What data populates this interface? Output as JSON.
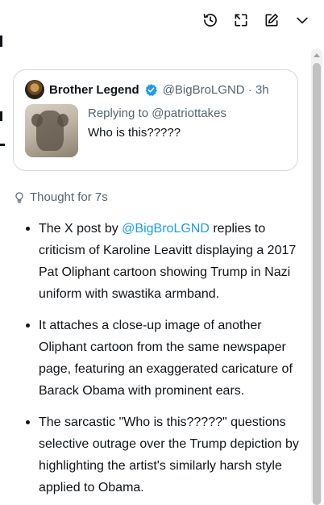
{
  "toolbar": {
    "buttons": [
      {
        "name": "history",
        "icon": "history-icon"
      },
      {
        "name": "expand",
        "icon": "expand-icon"
      },
      {
        "name": "new-chat",
        "icon": "compose-icon"
      },
      {
        "name": "collapse",
        "icon": "chevron-down-icon"
      }
    ]
  },
  "tweet": {
    "author": "Brother Legend",
    "handle_time": "@BigBroLGND · 3h",
    "replying_prefix": "Replying to ",
    "replying_to": "@patriottakes",
    "text": "Who is this?????"
  },
  "thought": {
    "label": "Thought for 7s",
    "icon": "lightbulb-icon"
  },
  "answer": {
    "bullet1_pre": "The X post by ",
    "bullet1_mention": "@BigBroLGND",
    "bullet1_post": " replies to criticism of Karoline Leavitt displaying a 2017 Pat Oliphant cartoon showing Trump in Nazi uniform with swastika armband.",
    "bullet2": "It attaches a close-up image of another Oliphant cartoon from the same newspaper page, featuring an exaggerated caricature of Barack Obama with prominent ears.",
    "bullet3": "The sarcastic \"Who is this?????\" questions selective outrage over the Trump depiction by highlighting the artist's similarly harsh style applied to Obama."
  },
  "colors": {
    "text": "#0f1419",
    "secondary": "#536471",
    "link": "#1d9bf0",
    "verified": "#1d9bf0",
    "border": "#cfd9de"
  }
}
